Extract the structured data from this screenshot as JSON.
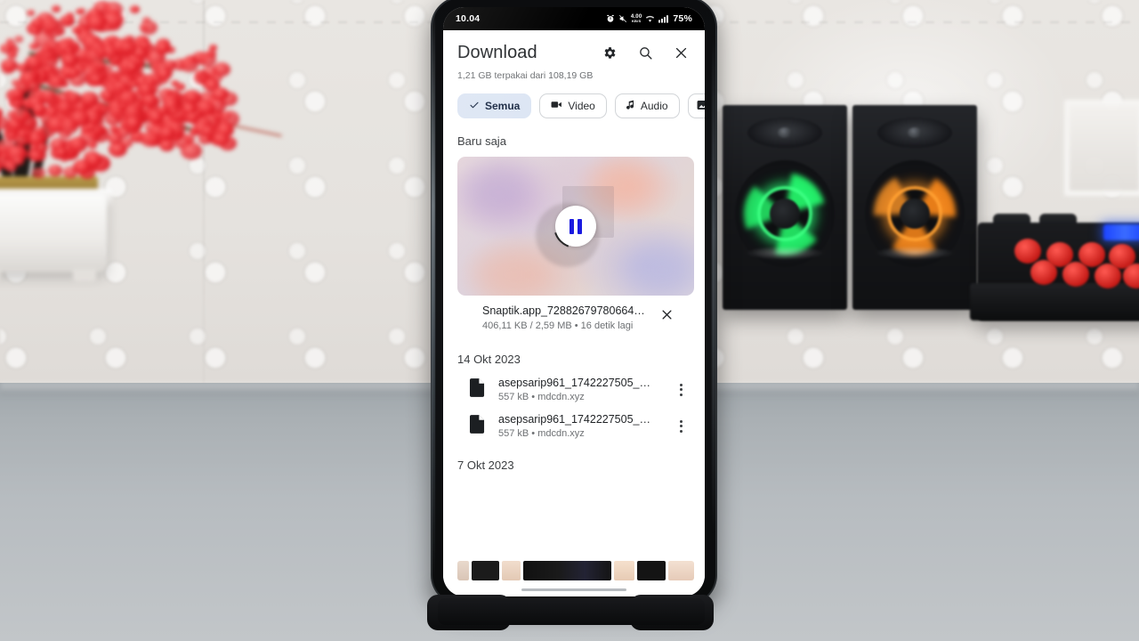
{
  "status_bar": {
    "time": "10.04",
    "icons": [
      "alarm-icon",
      "mute-icon",
      "data-speed-icon",
      "wifi-icon",
      "signal-icon"
    ],
    "data_speed": "4.00",
    "data_speed_unit": "KB/S",
    "battery": "75%"
  },
  "app": {
    "title": "Download",
    "storage": "1,21 GB terpakai dari 108,19 GB",
    "actions": [
      {
        "name": "settings-button",
        "icon": "gear-icon"
      },
      {
        "name": "search-button",
        "icon": "search-icon"
      },
      {
        "name": "close-button",
        "icon": "close-icon"
      }
    ],
    "chips": [
      {
        "label": "Semua",
        "icon": "check-icon",
        "selected": true
      },
      {
        "label": "Video",
        "icon": "video-icon",
        "selected": false
      },
      {
        "label": "Audio",
        "icon": "audio-note-icon",
        "selected": false
      },
      {
        "label": "",
        "icon": "image-icon",
        "selected": false
      }
    ],
    "recent_section": "Baru saja",
    "active_download": {
      "filename": "Snaptik.app_72882679780664…",
      "progress_text": "406,11 KB / 2,59 MB • 16 detik lagi",
      "downloaded": "406,11 KB",
      "total": "2,59 MB",
      "time_left": "16 detik lagi",
      "state": "downloading",
      "pause_icon": "pause-icon",
      "cancel_icon": "close-icon"
    },
    "groups": [
      {
        "date": "14 Okt 2023",
        "files": [
          {
            "name": "asepsarip961_1742227505_…",
            "meta": "557 kB • mdcdn.xyz",
            "size": "557 kB",
            "source": "mdcdn.xyz",
            "icon": "file-icon",
            "menu_icon": "kebab-menu-icon"
          },
          {
            "name": "asepsarip961_1742227505_…",
            "meta": "557 kB • mdcdn.xyz",
            "size": "557 kB",
            "source": "mdcdn.xyz",
            "icon": "file-icon",
            "menu_icon": "kebab-menu-icon"
          }
        ]
      },
      {
        "date": "7 Okt 2023",
        "files": []
      }
    ]
  },
  "colors": {
    "accent_blue": "#1a1ae0",
    "chip_selected_bg": "#dde6f4",
    "chip_selected_text": "#1b2a44",
    "text_primary": "#1f2225",
    "text_secondary": "#6d7073",
    "status_bar_bg": "#000000"
  }
}
